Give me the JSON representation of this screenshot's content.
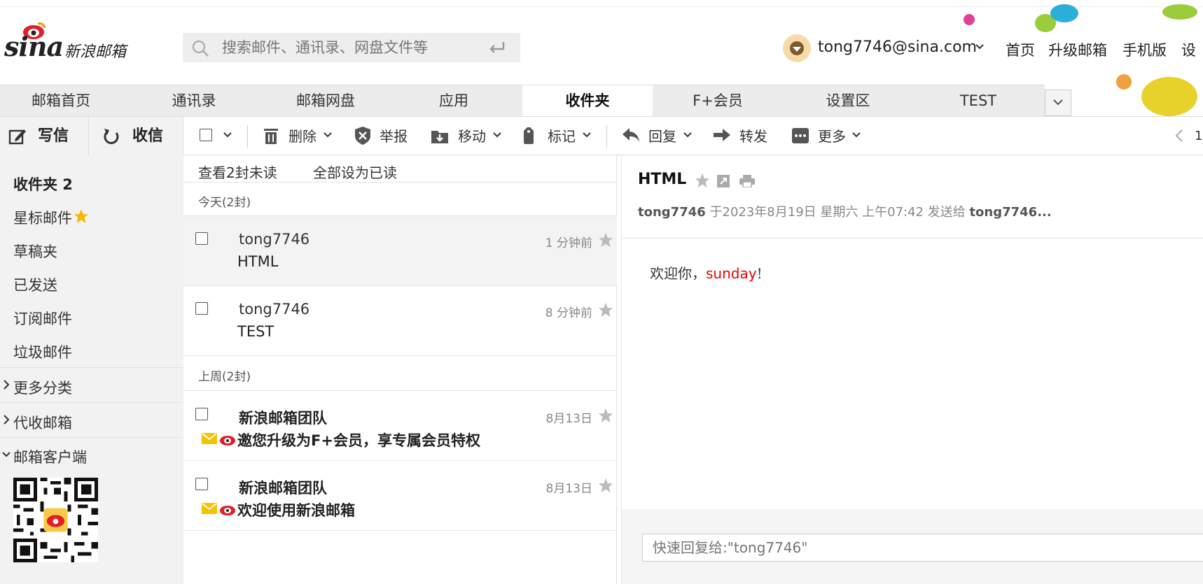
{
  "header": {
    "logo_text": "sina",
    "brand": "新浪邮箱",
    "search_placeholder": "搜索邮件、通讯录、网盘文件等",
    "account": "tong7746@sina.com",
    "links": [
      "首页",
      "升级邮箱",
      "手机版",
      "设"
    ]
  },
  "nav": {
    "tabs": [
      "邮箱首页",
      "通讯录",
      "邮箱网盘",
      "应用",
      "收件夹",
      "F+会员",
      "设置区",
      "TEST"
    ],
    "active": "收件夹"
  },
  "toolbar": {
    "write": "写信",
    "receive": "收信",
    "delete": "删除",
    "report": "举报",
    "move": "移动",
    "mark": "标记",
    "reply": "回复",
    "forward": "转发",
    "more": "更多",
    "page": "1"
  },
  "sidebar": {
    "folders": [
      "收件夹 2",
      "星标邮件",
      "草稿夹",
      "已发送",
      "订阅邮件",
      "垃圾邮件"
    ],
    "sections": [
      "更多分类",
      "代收邮箱",
      "邮箱客户端"
    ]
  },
  "list": {
    "actions": [
      "查看2封未读",
      "全部设为已读"
    ],
    "groups": [
      "今天(2封)",
      "上周(2封)"
    ],
    "messages": [
      {
        "sender": "tong7746",
        "subject": "HTML",
        "time": "1 分钟前"
      },
      {
        "sender": "tong7746",
        "subject": "TEST",
        "time": "8 分钟前"
      },
      {
        "sender": "新浪邮箱团队",
        "subject": "邀您升级为F+会员，享专属会员特权",
        "time": "8月13日"
      },
      {
        "sender": "新浪邮箱团队",
        "subject": "欢迎使用新浪邮箱",
        "time": "8月13日"
      }
    ]
  },
  "reader": {
    "subject": "HTML",
    "from": "tong7746",
    "meta_mid": " 于2023年8月19日 星期六 上午07:42 发送给 ",
    "to": "tong7746...",
    "body_prefix": "欢迎你，",
    "body_highlight": "sunday",
    "body_suffix": "!",
    "quick_reply_placeholder": "快速回复给:\"tong7746\""
  },
  "colors": {
    "accent_red": "#e00000",
    "tab_bg": "#ececec",
    "sidebar_bg": "#f2f2f2",
    "mail_icon": "#f5c400"
  }
}
